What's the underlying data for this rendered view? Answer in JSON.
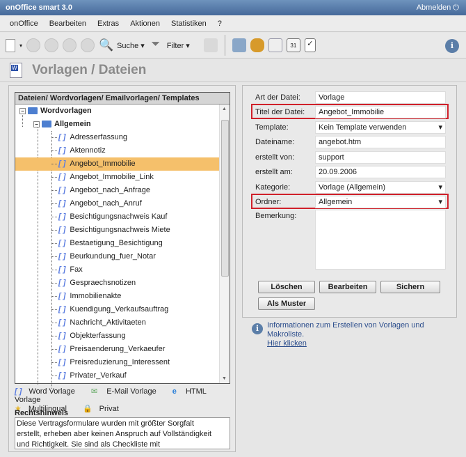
{
  "app": {
    "title": "onOffice smart 3.0",
    "logout": "Abmelden ⏻"
  },
  "menu": [
    "onOffice",
    "Bearbeiten",
    "Extras",
    "Aktionen",
    "Statistiken",
    "?"
  ],
  "toolbar": {
    "search": "Suche ▾",
    "filter": "Filter ▾"
  },
  "page_title": "Vorlagen / Dateien",
  "tree": {
    "header": "Dateien/ Wordvorlagen/ Emailvorlagen/ Templates",
    "root": "Wordvorlagen",
    "folder": "Allgemein",
    "items": [
      "Adresserfassung",
      "Aktennotiz",
      "Angebot_Immobilie",
      "Angebot_Immobilie_Link",
      "Angebot_nach_Anfrage",
      "Angebot_nach_Anruf",
      "Besichtigungsnachweis Kauf",
      "Besichtigungsnachweis Miete",
      "Bestaetigung_Besichtigung",
      "Beurkundung_fuer_Notar",
      "Fax",
      "Gespraechsnotizen",
      "Immobilienakte",
      "Kuendigung_Verkaufsauftrag",
      "Nachricht_Aktivitaeten",
      "Objekterfassung",
      "Preisaenderung_Verkaeufer",
      "Preisreduzierung_Interessent",
      "Privater_Verkauf"
    ],
    "selected": "Angebot_Immobilie"
  },
  "legend": {
    "word": "Word Vorlage",
    "email": "E-Mail Vorlage",
    "html": "HTML Vorlage",
    "multi": "Multilingual",
    "privat": "Privat"
  },
  "rechtshinweis": {
    "label": "Rechtshinweis",
    "text": "Diese Vertragsformulare wurden mit größter Sorgfalt erstellt, erheben aber keinen Anspruch auf Vollständigkeit und Richtigkeit. Sie sind als Checkliste mit Formulierungshilfen zu verstehen und sollen..."
  },
  "form": [
    {
      "label": "Art der Datei:",
      "value": "Vorlage"
    },
    {
      "label": "Titel der Datei:",
      "value": "Angebot_Immobilie"
    },
    {
      "label": "Template:",
      "value": "Kein Template verwenden"
    },
    {
      "label": "Dateiname:",
      "value": "angebot.htm"
    },
    {
      "label": "erstellt von:",
      "value": "support"
    },
    {
      "label": "erstellt am:",
      "value": "20.09.2006"
    },
    {
      "label": "Kategorie:",
      "value": "Vorlage (Allgemein)"
    },
    {
      "label": "Ordner:",
      "value": "Allgemein"
    }
  ],
  "bemerkung": "Bemerkung:",
  "buttons": {
    "delete": "Löschen",
    "edit": "Bearbeiten",
    "save": "Sichern",
    "pattern": "Als Muster"
  },
  "info": {
    "text": "Informationen zum Erstellen von Vorlagen und Makroliste.",
    "link": "Hier klicken"
  }
}
